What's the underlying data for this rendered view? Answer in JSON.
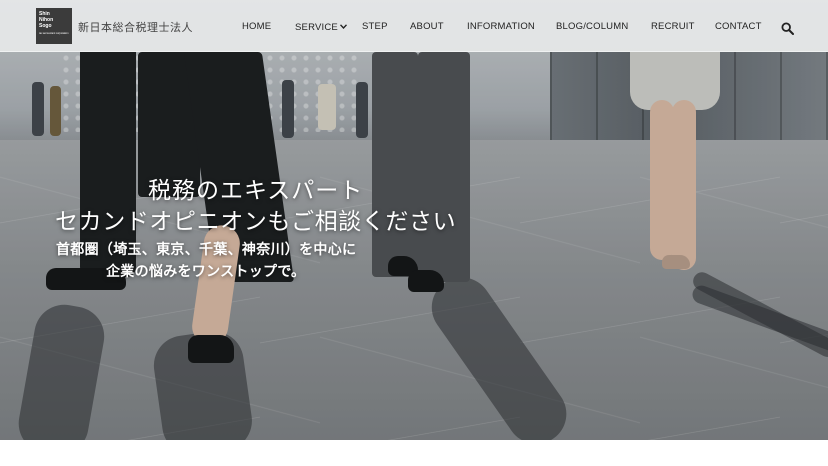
{
  "header": {
    "logo_lines": [
      "Shin",
      "Nihon",
      "Sogo"
    ],
    "logo_tagline": "tax accountant corporation",
    "brand_name": "新日本総合税理士法人",
    "search_icon": "search-icon"
  },
  "nav": {
    "items": [
      {
        "label": "HOME"
      },
      {
        "label": "SERVICE",
        "has_dropdown": true
      },
      {
        "label": "STEP"
      },
      {
        "label": "ABOUT"
      },
      {
        "label": "INFORMATION"
      },
      {
        "label": "BLOG/COLUMN"
      },
      {
        "label": "RECRUIT"
      },
      {
        "label": "CONTACT"
      }
    ]
  },
  "hero": {
    "headline_line1": "税務のエキスパート",
    "headline_line2": "セカンドオピニオンもご相談ください",
    "sub_line1": "首都圏（埼玉、東京、千葉、神奈川）を中心に",
    "sub_line2": "企業の悩みをワンストップで。"
  },
  "colors": {
    "header_bg": "#f5f6f7",
    "text_dark": "#222222",
    "hero_text": "#ffffff",
    "logo_bg": "#3b3b3b"
  }
}
